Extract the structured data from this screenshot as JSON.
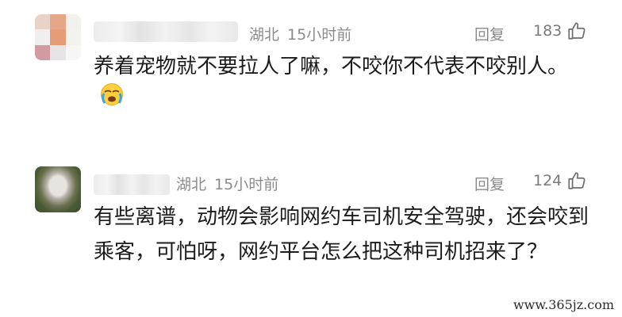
{
  "comments": [
    {
      "location": "湖北",
      "time": "15小时前",
      "reply_label": "回复",
      "likes": "183",
      "text": "养着宠物就不要拉人了嘛，不咬你不代表不咬别人。"
    },
    {
      "location": "湖北",
      "time": "15小时前",
      "reply_label": "回复",
      "likes": "124",
      "text": "有些离谱，动物会影响网约车司机安全驾驶，还会咬到乘客，可怕呀，网约平台怎么把这种司机招来了？"
    }
  ],
  "icons": {
    "like": "thumbs-up-icon",
    "emoji": "crying-face-emoji"
  },
  "colors": {
    "meta_gray": "#8b8b8b",
    "text": "#1c1c1c"
  },
  "watermark": "www.365jz.com"
}
